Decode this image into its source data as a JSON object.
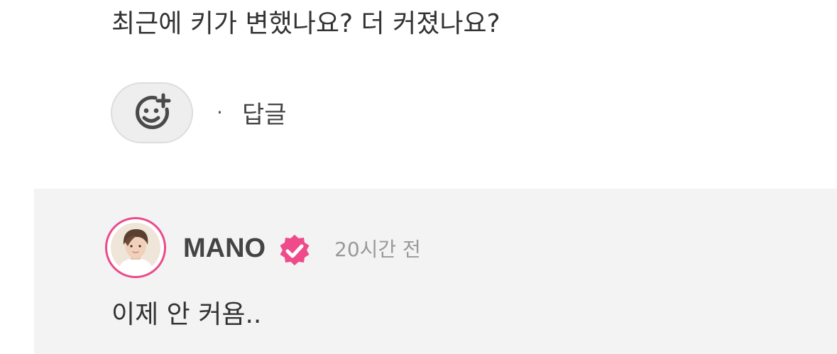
{
  "comment": {
    "text": "최근에 키가 변했나요? 더 커졌나요?",
    "reaction_icon": "smiley-plus-icon",
    "separator": "·",
    "reply_label": "답글"
  },
  "reply": {
    "username": "MANO",
    "verified_icon": "verified-badge-icon",
    "timestamp": "20시간 전",
    "text": "이제 안 커욤..",
    "avatar_ring_color": "#ea4b8b",
    "badge_color": "#ef4b8a"
  }
}
